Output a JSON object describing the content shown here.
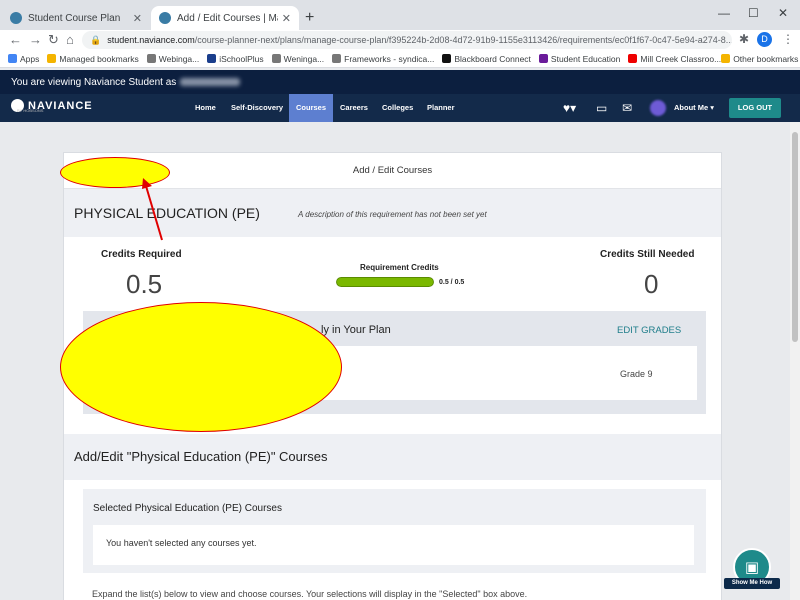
{
  "browser": {
    "tabs": [
      {
        "title": "Student Course Plan",
        "active": false
      },
      {
        "title": "Add / Edit Courses | Manage Co",
        "active": true
      }
    ],
    "url_host": "student.naviance.com",
    "url_path": "/course-planner-next/plans/manage-course-plan/f395224b-2d08-4d72-91b9-1155e3113426/requirements/ec0f1f67-0c47-5e94-a274-8...",
    "profile_initial": "D",
    "bookmarks": [
      "Apps",
      "Managed bookmarks",
      "Webinga...",
      "iSchoolPlus",
      "Weninga...",
      "Frameworks - syndica...",
      "Blackboard Connect",
      "Student Education",
      "Mill Creek Classroo..."
    ],
    "other_bookmarks": "Other bookmarks"
  },
  "naviance": {
    "viewing_banner": "You are viewing Naviance Student as",
    "logo_text": "NAVIANCE",
    "logo_sub": "BY HOBSONS",
    "nav": [
      "Home",
      "Self-Discovery",
      "Courses",
      "Careers",
      "Colleges",
      "Planner"
    ],
    "active_nav": "Courses",
    "about_me": "About Me ▾",
    "logout": "LOG OUT"
  },
  "page": {
    "header": "Add / Edit Courses",
    "requirement_title": "PHYSICAL EDUCATION (PE)",
    "requirement_desc": "A description of this requirement has not been set yet",
    "credits_required_label": "Credits Required",
    "credits_required_value": "0.5",
    "requirement_credits_label": "Requirement Credits",
    "requirement_credits_text": "0.5 / 0.5",
    "requirement_progress": 1.0,
    "credits_needed_label": "Credits Still Needed",
    "credits_needed_value": "0",
    "plan_title": "ly in Your Plan",
    "edit_grades": "EDIT GRADES",
    "grade": "Grade 9",
    "section_title": "Add/Edit \"Physical Education (PE)\" Courses",
    "selected_title": "Selected Physical Education (PE) Courses",
    "selected_empty": "You haven't selected any courses yet.",
    "expand_hint": "Expand the list(s) below to view and choose courses. Your selections will display in the \"Selected\" box above."
  },
  "show_me_how": "Show Me How",
  "colors": {
    "navbar": "#132a4a",
    "active_nav": "#5d7fd0",
    "progress": "#7ab800",
    "teal": "#1e8a8a",
    "annotation_fill": "#ffff00",
    "annotation_stroke": "#e00000"
  }
}
